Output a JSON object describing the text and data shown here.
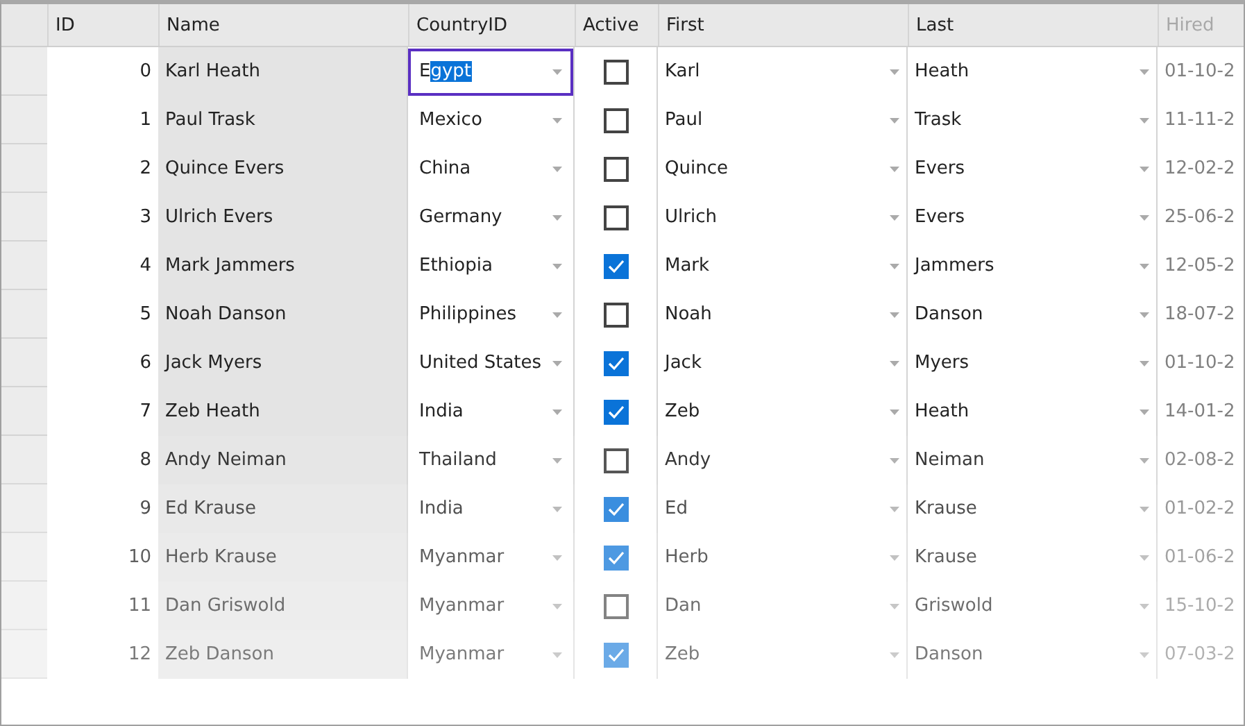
{
  "table": {
    "columns": [
      "ID",
      "Name",
      "CountryID",
      "Active",
      "First",
      "Last",
      "Hired"
    ],
    "rows": [
      {
        "id": "0",
        "name": "Karl Heath",
        "editing": true,
        "country_typed": "E",
        "country_selection": "gypt",
        "active": false,
        "first": "Karl",
        "last": "Heath",
        "hired": "01-10-2"
      },
      {
        "id": "1",
        "name": "Paul Trask",
        "country": "Mexico",
        "editing": false,
        "active": false,
        "first": "Paul",
        "last": "Trask",
        "hired": "11-11-2"
      },
      {
        "id": "2",
        "name": "Quince Evers",
        "country": "China",
        "editing": false,
        "active": false,
        "first": "Quince",
        "last": "Evers",
        "hired": "12-02-2"
      },
      {
        "id": "3",
        "name": "Ulrich Evers",
        "country": "Germany",
        "editing": false,
        "active": false,
        "first": "Ulrich",
        "last": "Evers",
        "hired": "25-06-2"
      },
      {
        "id": "4",
        "name": "Mark Jammers",
        "country": "Ethiopia",
        "editing": false,
        "active": true,
        "first": "Mark",
        "last": "Jammers",
        "hired": "12-05-2"
      },
      {
        "id": "5",
        "name": "Noah Danson",
        "country": "Philippines",
        "editing": false,
        "active": false,
        "first": "Noah",
        "last": "Danson",
        "hired": "18-07-2"
      },
      {
        "id": "6",
        "name": "Jack Myers",
        "country": "United States",
        "editing": false,
        "active": true,
        "first": "Jack",
        "last": "Myers",
        "hired": "01-10-2"
      },
      {
        "id": "7",
        "name": "Zeb Heath",
        "country": "India",
        "editing": false,
        "active": true,
        "first": "Zeb",
        "last": "Heath",
        "hired": "14-01-2"
      },
      {
        "id": "8",
        "name": "Andy Neiman",
        "country": "Thailand",
        "editing": false,
        "active": false,
        "first": "Andy",
        "last": "Neiman",
        "hired": "02-08-2"
      },
      {
        "id": "9",
        "name": "Ed Krause",
        "country": "India",
        "editing": false,
        "active": true,
        "first": "Ed",
        "last": "Krause",
        "hired": "01-02-2"
      },
      {
        "id": "10",
        "name": "Herb Krause",
        "country": "Myanmar",
        "editing": false,
        "active": true,
        "first": "Herb",
        "last": "Krause",
        "hired": "01-06-2"
      },
      {
        "id": "11",
        "name": "Dan Griswold",
        "country": "Myanmar",
        "editing": false,
        "active": false,
        "first": "Dan",
        "last": "Griswold",
        "hired": "15-10-2"
      },
      {
        "id": "12",
        "name": "Zeb Danson",
        "country": "Myanmar",
        "editing": false,
        "active": true,
        "first": "Zeb",
        "last": "Danson",
        "hired": "07-03-2"
      }
    ]
  }
}
